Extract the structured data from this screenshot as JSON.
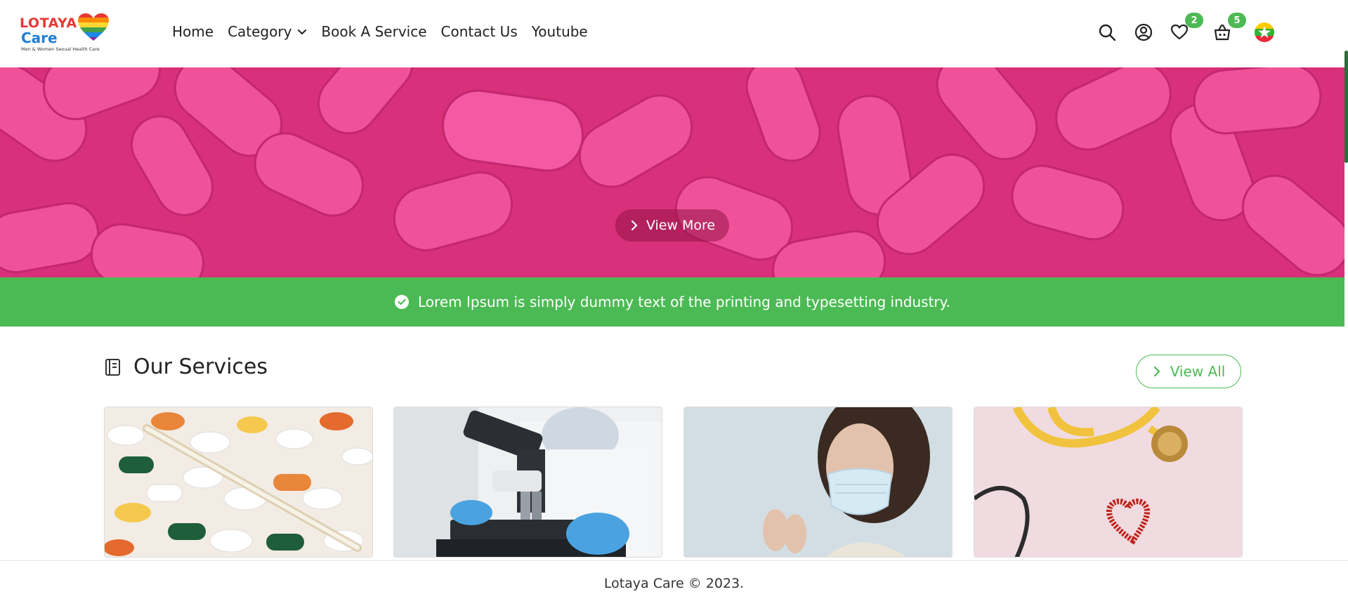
{
  "brand": {
    "name_line1": "LOTAYA",
    "name_line2": "Care",
    "tagline": "Men & Women Sexual Health Care"
  },
  "nav": {
    "items": [
      {
        "label": "Home"
      },
      {
        "label": "Category"
      },
      {
        "label": "Book A Service"
      },
      {
        "label": "Contact Us"
      },
      {
        "label": "Youtube"
      }
    ]
  },
  "header_icons": {
    "wishlist_count": "2",
    "cart_count": "5",
    "icons": [
      "search-icon",
      "account-icon",
      "heart-icon",
      "basket-icon",
      "myanmar-flag-icon"
    ]
  },
  "hero": {
    "button_label": "View More"
  },
  "notice": {
    "text": "Lorem Ipsum is simply dummy text of the printing and typesetting industry."
  },
  "services": {
    "title": "Our Services",
    "view_all_label": "View All"
  },
  "footer": {
    "text": "Lotaya Care © 2023."
  },
  "colors": {
    "accent_green": "#4cba54",
    "hero_pink": "#e8408f"
  }
}
